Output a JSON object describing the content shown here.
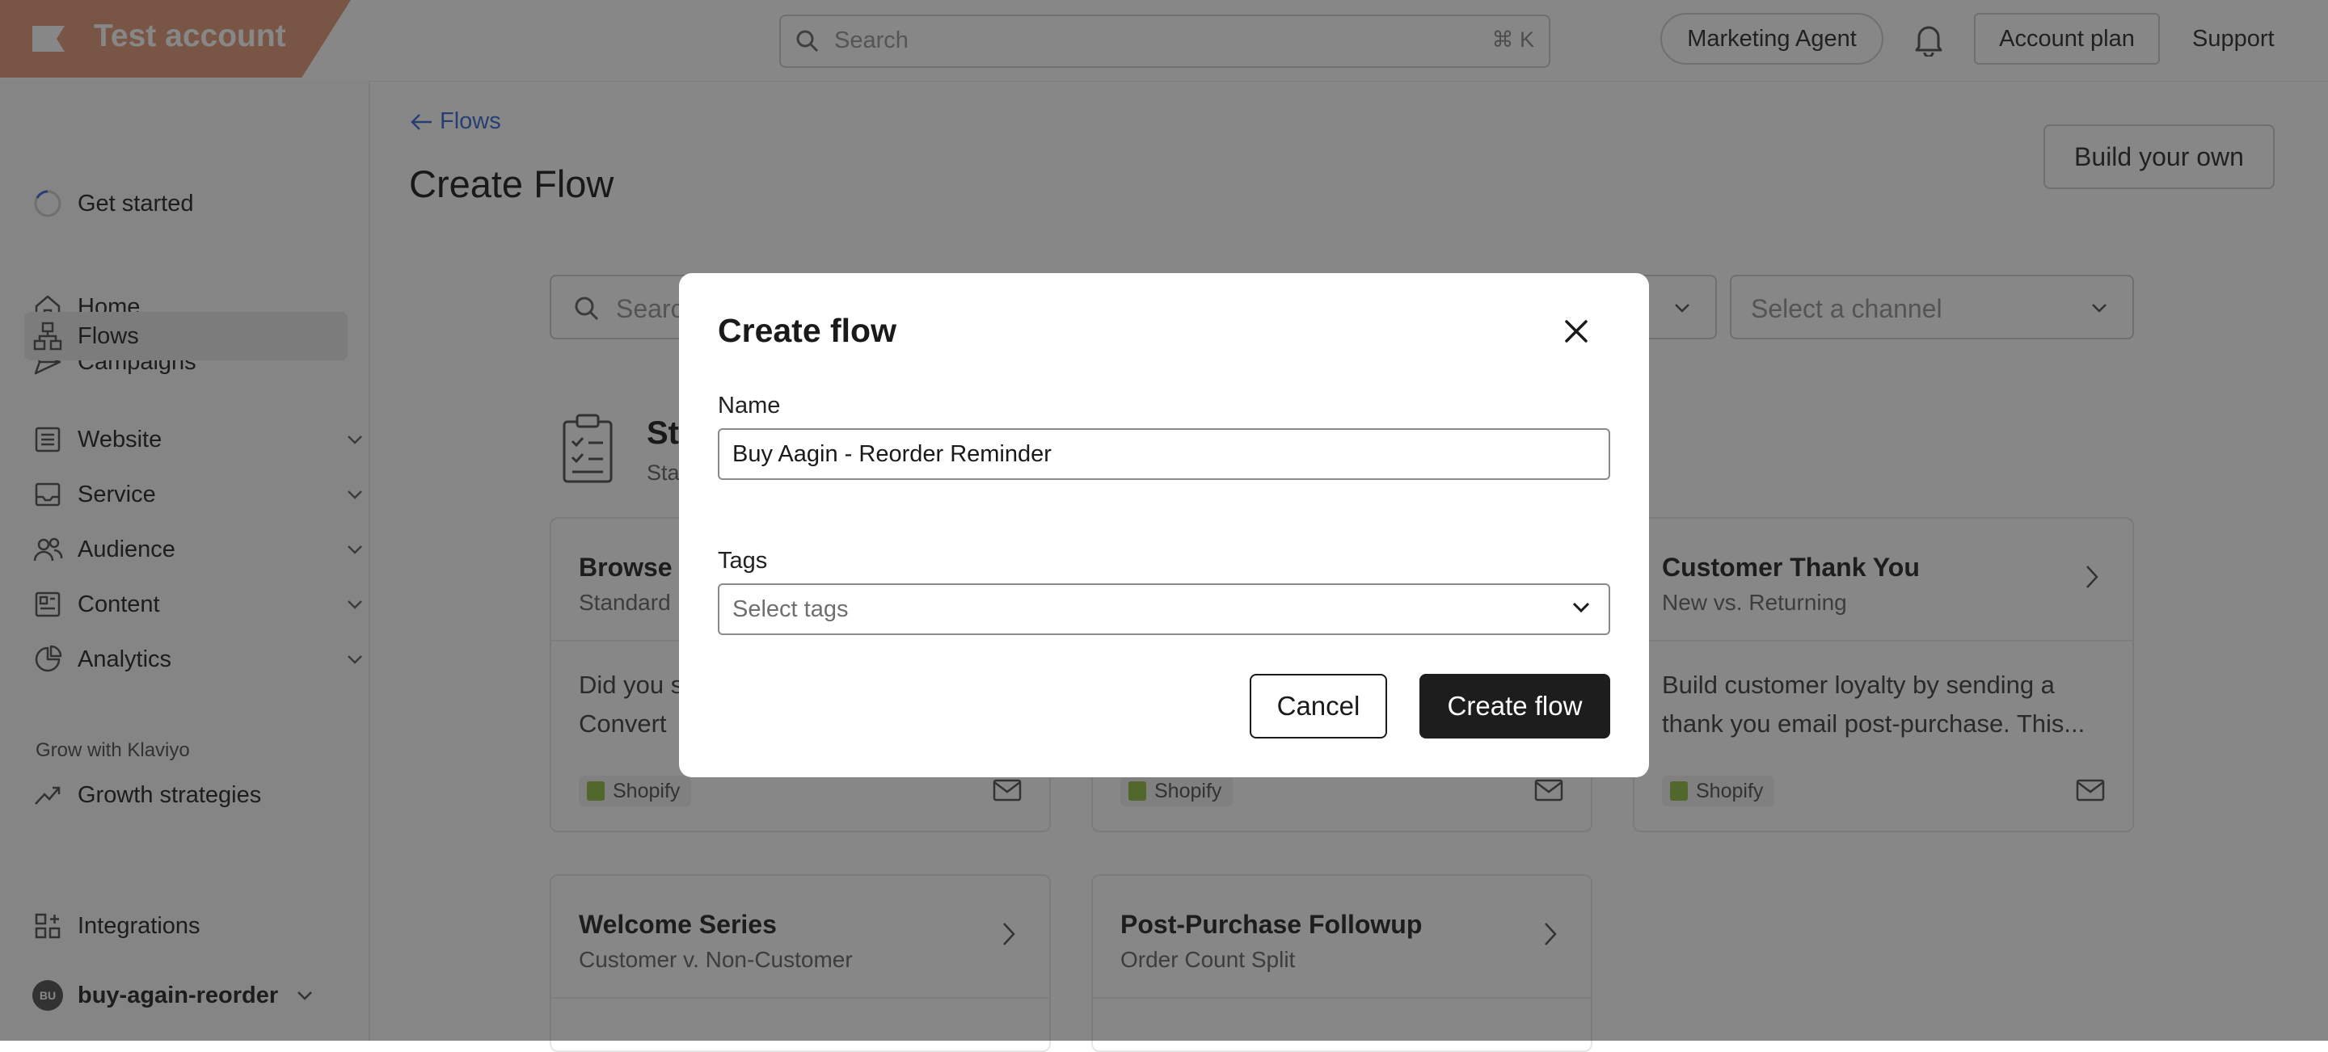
{
  "topbar": {
    "account_name": "Test account",
    "search_placeholder": "Search",
    "search_shortcut": "⌘ K",
    "agent_button": "Marketing Agent",
    "account_plan": "Account plan",
    "support": "Support"
  },
  "sidebar": {
    "get_started": "Get started",
    "items": [
      {
        "label": "Home",
        "icon": "home-icon"
      },
      {
        "label": "Campaigns",
        "icon": "send-icon"
      },
      {
        "label": "Flows",
        "icon": "flows-icon",
        "active": true
      },
      {
        "label": "Website",
        "icon": "website-icon",
        "expandable": true
      },
      {
        "label": "Service",
        "icon": "inbox-icon",
        "expandable": true
      },
      {
        "label": "Audience",
        "icon": "audience-icon",
        "expandable": true
      },
      {
        "label": "Content",
        "icon": "content-icon",
        "expandable": true
      },
      {
        "label": "Analytics",
        "icon": "analytics-icon",
        "expandable": true
      }
    ],
    "grow_label": "Grow with Klaviyo",
    "growth": "Growth strategies",
    "integrations": "Integrations",
    "user": {
      "initials": "BU",
      "name": "buy-again-reorder"
    }
  },
  "main": {
    "back_link": "Flows",
    "page_title": "Create Flow",
    "build_button": "Build your own",
    "search_placeholder": "Search",
    "channel_placeholder": "Select a channel",
    "section_title": "St",
    "section_sub": "Sta",
    "cards": [
      {
        "title": "Browse A",
        "subtitle": "Standard",
        "desc_line1": "Did you s",
        "desc_line2": "Convert",
        "badge": "Shopify"
      },
      {
        "title": "",
        "subtitle": "",
        "desc_line1": "",
        "desc_line2": "",
        "badge": "Shopify"
      },
      {
        "title": "Customer Thank You",
        "subtitle": "New vs. Returning",
        "desc_line1": "Build customer loyalty by sending a",
        "desc_line2": "thank you email post-purchase. This...",
        "badge": "Shopify"
      },
      {
        "title": "Welcome Series",
        "subtitle": "Customer v. Non-Customer"
      },
      {
        "title": "Post-Purchase Followup",
        "subtitle": "Order Count Split"
      }
    ]
  },
  "modal": {
    "title": "Create flow",
    "name_label": "Name",
    "name_value": "Buy Aagin - Reorder Reminder",
    "tags_label": "Tags",
    "tags_placeholder": "Select tags",
    "cancel": "Cancel",
    "create": "Create flow"
  },
  "colors": {
    "accent_tag": "#e29a7d",
    "link": "#3d6fd6",
    "primary_button": "#1d1d1d",
    "shopify": "#95bf47"
  }
}
